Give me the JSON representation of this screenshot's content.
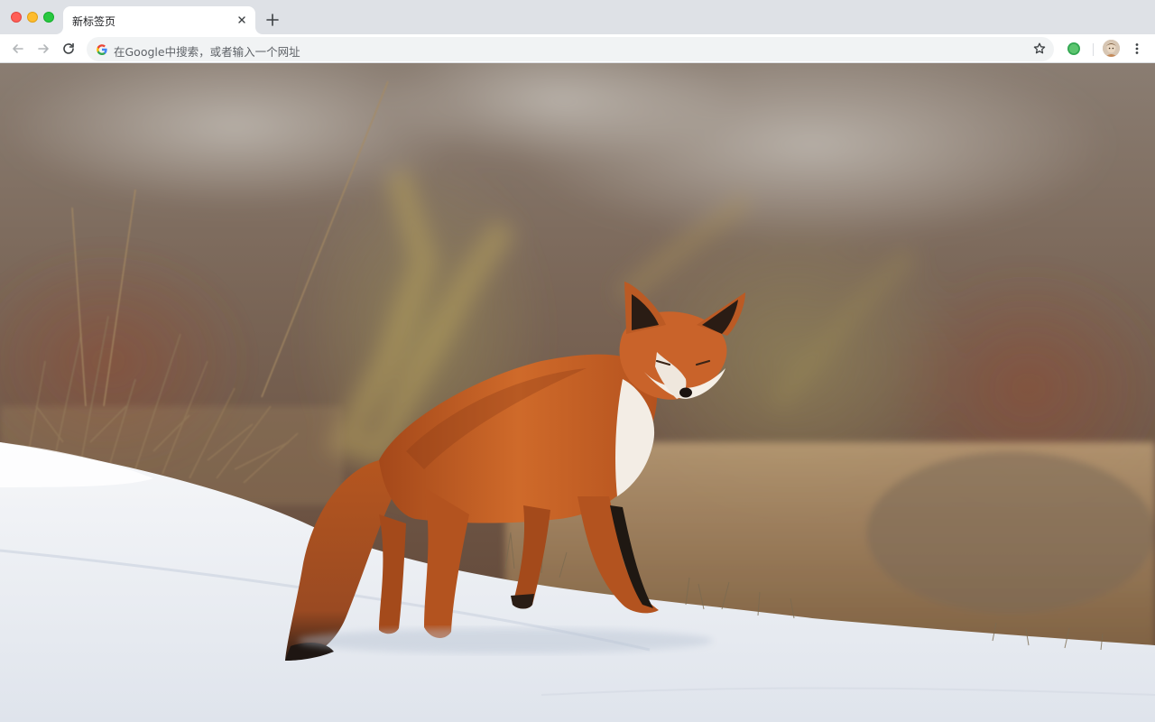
{
  "window": {
    "controls": [
      "close",
      "minimize",
      "maximize"
    ]
  },
  "tabs": [
    {
      "title": "新标签页",
      "active": true
    }
  ],
  "toolbar": {
    "omnibox_placeholder": "在Google中搜索，或者输入一个网址",
    "icons": [
      "back-icon",
      "forward-icon",
      "reload-icon",
      "google-g-icon",
      "star-icon",
      "extension-icon",
      "profile-avatar",
      "menu-icon"
    ]
  },
  "background": {
    "subject": "photo",
    "colors": {
      "snow": "#eef1f5",
      "fur": "#c25a1c",
      "grass": "#b9986a",
      "blur_bg": "#6e5a4a"
    }
  }
}
